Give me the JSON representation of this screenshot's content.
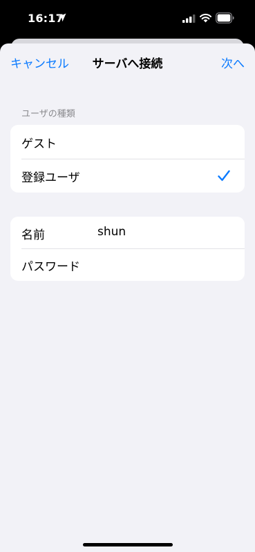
{
  "status_bar": {
    "time": "16:17"
  },
  "nav": {
    "cancel_label": "キャンセル",
    "title": "サーバへ接続",
    "next_label": "次へ"
  },
  "user_type": {
    "header": "ユーザの種類",
    "options": [
      {
        "label": "ゲスト",
        "selected": false
      },
      {
        "label": "登録ユーザ",
        "selected": true
      }
    ]
  },
  "credentials": {
    "name_label": "名前",
    "name_value": "shun",
    "password_label": "パスワード",
    "password_value": ""
  },
  "colors": {
    "accent": "#0a7aff",
    "background": "#f2f2f7",
    "secondary_text": "#8a8a8e"
  },
  "icons": {
    "location": "location-arrow-icon",
    "signal": "cellular-signal-icon",
    "wifi": "wifi-icon",
    "battery": "battery-icon",
    "check": "checkmark-icon"
  }
}
